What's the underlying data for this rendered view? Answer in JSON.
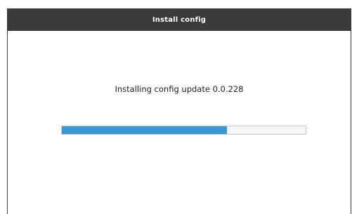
{
  "window": {
    "title": "Install config"
  },
  "status": {
    "message": "Installing config update 0.0.228"
  },
  "progress": {
    "fraction": 0.676,
    "fill_color": "#3a97d6"
  },
  "colors": {
    "titlebar": "#3b3b3b",
    "background": "#ffffff"
  }
}
